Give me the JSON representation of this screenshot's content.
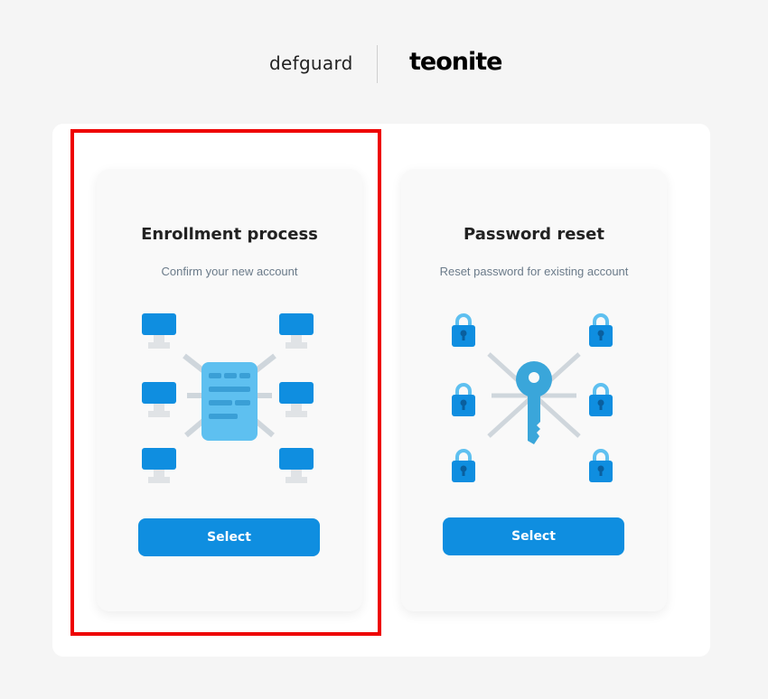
{
  "logos": {
    "left": "defguard",
    "right": "teonite"
  },
  "cards": [
    {
      "title": "Enrollment process",
      "subtitle": "Confirm your new account",
      "button_label": "Select",
      "illustration": "server-network-icon"
    },
    {
      "title": "Password reset",
      "subtitle": "Reset password for existing account",
      "button_label": "Select",
      "illustration": "key-locks-icon"
    }
  ],
  "colors": {
    "accent": "#0f8ee0",
    "highlight": "#ee0000",
    "server_light": "#5ec0f0",
    "key": "#3aa6da",
    "lock": "#0f8ee0",
    "ray": "#cfd6dc"
  }
}
